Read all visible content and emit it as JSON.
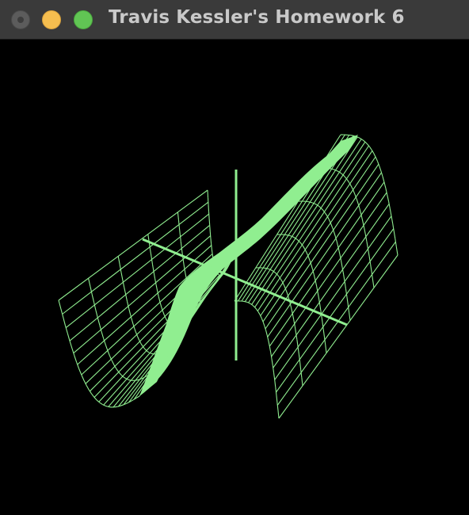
{
  "window": {
    "title": "Travis Kessler's Homework 6"
  },
  "titlebar_buttons": {
    "close_icon": "close-dot",
    "minimize_icon": "minimize-dot",
    "zoom_icon": "zoom-dot"
  },
  "colors": {
    "background": "#000000",
    "wireframe": "#90ee90",
    "titlebar": "#3a3a3a",
    "title_text": "#c9c9c9",
    "close": "#5c5c5c",
    "minimize": "#f6be4f",
    "zoom": "#61c554"
  },
  "scene": {
    "surface": "wireframe-sine-surface",
    "axes": [
      "x-axis",
      "z-axis"
    ]
  }
}
